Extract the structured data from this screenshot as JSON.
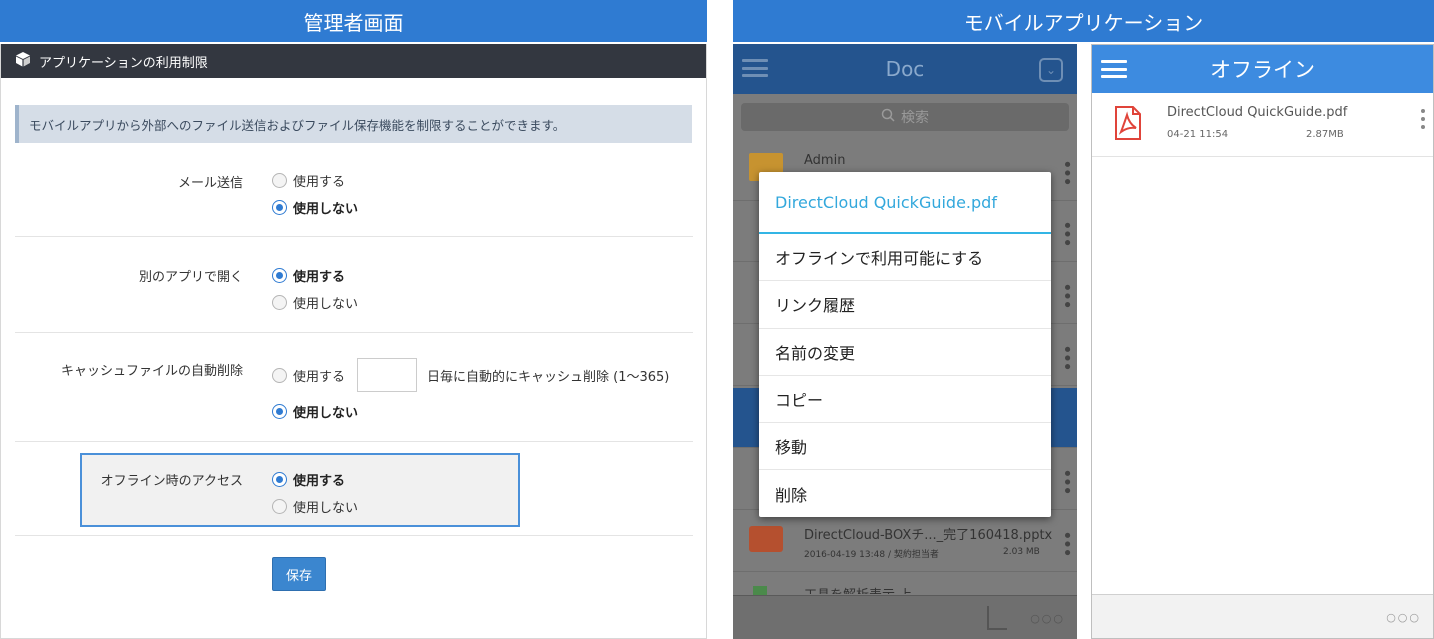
{
  "headers": {
    "admin": "管理者画面",
    "mobile": "モバイルアプリケーション"
  },
  "admin": {
    "bar_title": "アプリケーションの利用制限",
    "info": "モバイルアプリから外部へのファイル送信およびファイル保存機能を制限することができます。",
    "settings": [
      {
        "label": "メール送信",
        "options": [
          "使用する",
          "使用しない"
        ],
        "selected": 1
      },
      {
        "label": "別のアプリで開く",
        "options": [
          "使用する",
          "使用しない"
        ],
        "selected": 0
      },
      {
        "label": "キャッシュファイルの自動削除",
        "options": [
          "使用する",
          "使用しない"
        ],
        "selected": 1,
        "suffix": "日毎に自動的にキャッシュ削除 (1～365)"
      },
      {
        "label": "オフライン時のアクセス",
        "options": [
          "使用する",
          "使用しない"
        ],
        "selected": 0
      }
    ],
    "save_label": "保存"
  },
  "phone1": {
    "title": "Doc",
    "search_placeholder": "検索",
    "items": [
      {
        "name": "Admin"
      },
      {
        "name": "DirectCloud-BOXチ..._完了160418.pptx",
        "date": "2016-04-19 13:48 / 契約担当者",
        "size": "2.03 MB"
      },
      {
        "name": "工具を解析表示 上"
      }
    ],
    "dialog": {
      "title": "DirectCloud QuickGuide.pdf",
      "items": [
        "オフラインで利用可能にする",
        "リンク履歴",
        "名前の変更",
        "コピー",
        "移動",
        "削除"
      ]
    },
    "bottom_more": "○○○"
  },
  "phone2": {
    "title": "オフライン",
    "file": {
      "name": "DirectCloud QuickGuide.pdf",
      "date": "04-21 11:54",
      "size": "2.87MB"
    },
    "bottom_more": "○○○"
  },
  "colors": {
    "header_blue": "#2f7bd2",
    "admin_bar": "#333740",
    "radio_selected": "#2f7bd2",
    "dialog_accent": "#33b5e5",
    "phone2_bar": "#3d8be0",
    "pdf_red": "#e0443a"
  }
}
